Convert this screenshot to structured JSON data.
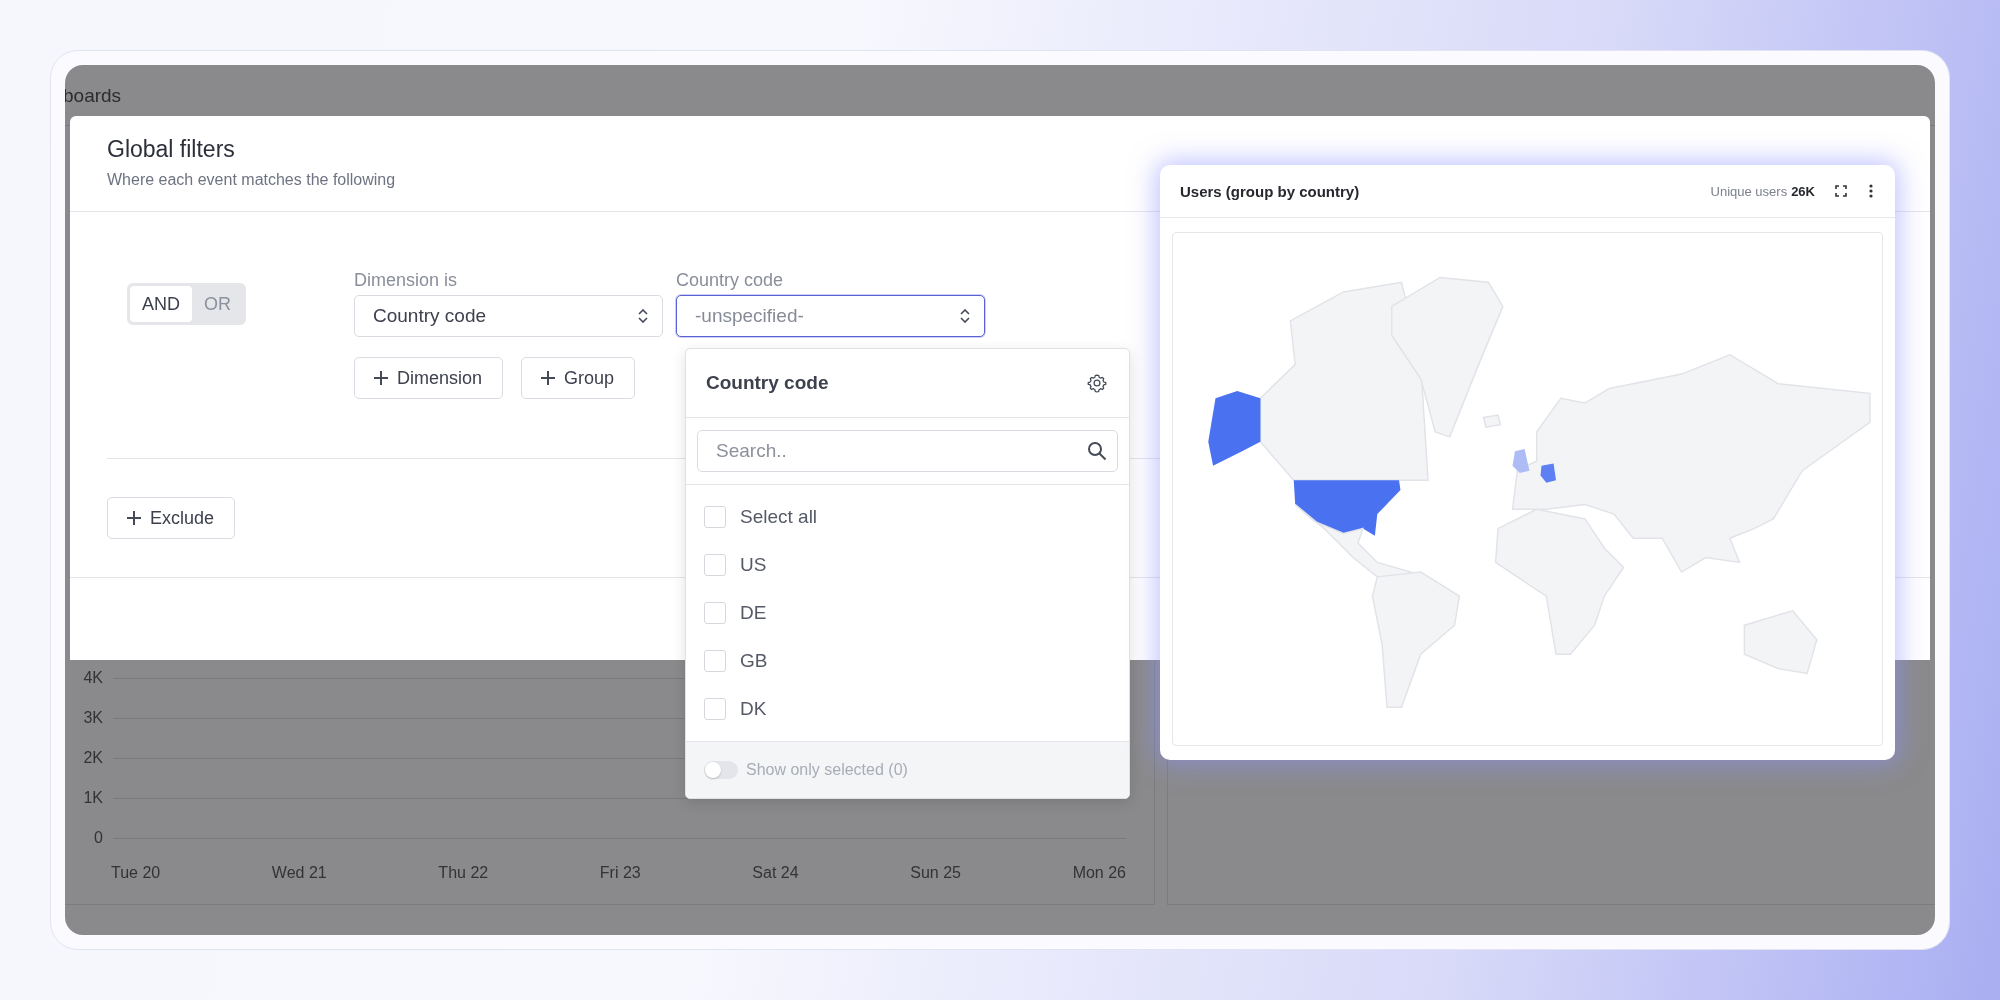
{
  "dashboard": {
    "title": "boards",
    "chart": {
      "y_labels": [
        "4K",
        "3K",
        "2K",
        "1K",
        "0"
      ],
      "x_labels": [
        "Tue 20",
        "Wed 21",
        "Thu 22",
        "Fri 23",
        "Sat 24",
        "Sun 25",
        "Mon 26"
      ]
    }
  },
  "modal": {
    "title": "Global filters",
    "subtitle": "Where each event matches the following",
    "logic": [
      {
        "label": "AND",
        "selected": true
      },
      {
        "label": "OR",
        "selected": false
      }
    ],
    "dimension": {
      "label": "Dimension is",
      "value": "Country code"
    },
    "value_select": {
      "label": "Country code",
      "placeholder": "-unspecified-"
    },
    "add_buttons": [
      "Dimension",
      "Group"
    ],
    "exclude_button": "Exclude"
  },
  "dropdown": {
    "title": "Country code",
    "search": {
      "placeholder": "Search.."
    },
    "options": [
      {
        "label": "Select all",
        "checked": false
      },
      {
        "label": "US",
        "checked": false
      },
      {
        "label": "DE",
        "checked": false
      },
      {
        "label": "GB",
        "checked": false
      },
      {
        "label": "DK",
        "checked": false
      }
    ],
    "show_only_selected": {
      "label": "Show only selected (0)",
      "on": false
    }
  },
  "map_card": {
    "title": "Users (group by country)",
    "metric_label": "Unique users",
    "metric_value": "26K"
  }
}
